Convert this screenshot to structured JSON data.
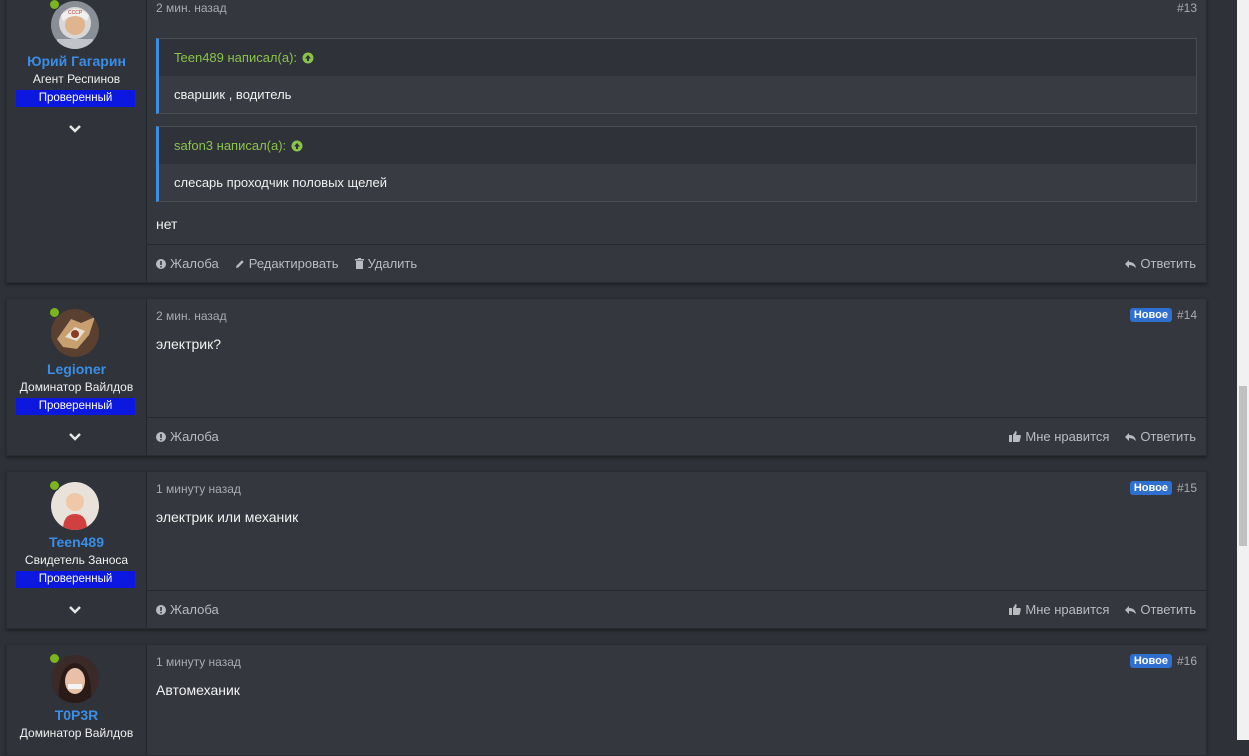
{
  "posts": [
    {
      "username": "Юрий Гагарин",
      "user_title": "Агент Респинов",
      "badge": "Проверенный",
      "time": "2 мин. назад",
      "number": "#13",
      "quotes": [
        {
          "author": "Teen489 написал(а):",
          "text": "сваршик , водитель"
        },
        {
          "author": "safon3 написал(а):",
          "text": "слесарь проходчик половых щелей"
        }
      ],
      "message": "нет",
      "actions": {
        "report": "Жалоба",
        "edit": "Редактировать",
        "delete": "Удалить",
        "reply": "Ответить"
      }
    },
    {
      "username": "Legioner",
      "user_title": "Доминатор Вайлдов",
      "badge": "Проверенный",
      "time": "2 мин. назад",
      "new_label": "Новое",
      "number": "#14",
      "message": "электрик?",
      "actions": {
        "report": "Жалоба",
        "like": "Мне нравится",
        "reply": "Ответить"
      }
    },
    {
      "username": "Teen489",
      "user_title": "Свидетель Заноса",
      "badge": "Проверенный",
      "time": "1 минуту назад",
      "new_label": "Новое",
      "number": "#15",
      "message": "электрик или механик",
      "actions": {
        "report": "Жалоба",
        "like": "Мне нравится",
        "reply": "Ответить"
      }
    },
    {
      "username": "T0P3R",
      "user_title": "Доминатор Вайлдов",
      "time": "1 минуту назад",
      "new_label": "Новое",
      "number": "#16",
      "message": "Автомеханик"
    }
  ],
  "colors": {
    "username": "#3a8ee6",
    "badge": "#0c18e0",
    "online": "#7ab51d",
    "quote_author": "#8bc34a",
    "new_badge": "#2f6fd0"
  },
  "icons": [
    "exclamation-circle-icon",
    "pencil-icon",
    "trash-icon",
    "reply-icon",
    "thumbs-up-icon",
    "chevron-down-icon",
    "arrow-up-circle-icon"
  ]
}
